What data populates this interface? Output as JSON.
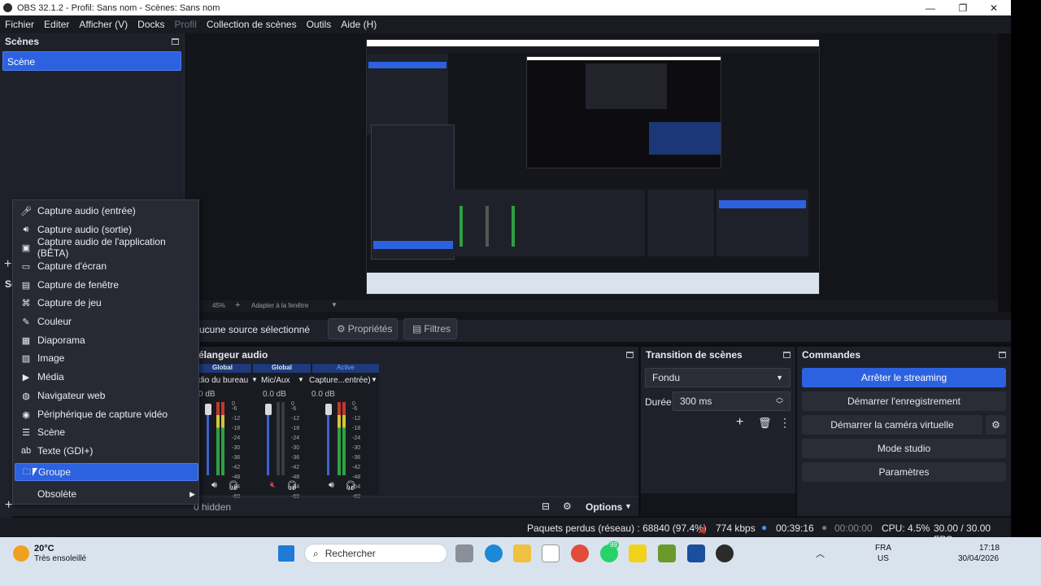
{
  "window": {
    "title": "OBS 32.1.2 - Profil: Sans nom - Scènes: Sans nom"
  },
  "menubar": [
    "Fichier",
    "Editer",
    "Afficher (V)",
    "Docks",
    "Profil",
    "Collection de scènes",
    "Outils",
    "Aide (H)"
  ],
  "scenes": {
    "title": "Scènes",
    "items": [
      "Scène"
    ]
  },
  "preview": {
    "zoom": "45%",
    "fit_label": "Adapter à la fenêtre"
  },
  "sources_bar": {
    "no_source": "ucune source sélectionné",
    "props": "Propriétés",
    "filters": "Filtres"
  },
  "mixer": {
    "title": "élangeur audio",
    "channels": [
      {
        "badge": "Global",
        "name": "dio du bureau",
        "db": "0 dB",
        "level": 0.7,
        "muted": false
      },
      {
        "badge": "Global",
        "name": "Mic/Aux",
        "db": "0.0 dB",
        "level": 0.0,
        "muted": true
      },
      {
        "badge": "Active",
        "name": "Capture...entrée)",
        "db": "0.0 dB",
        "level": 0.45,
        "muted": false
      }
    ],
    "scale": [
      "0",
      "-6",
      "-12",
      "-18",
      "-24",
      "-30",
      "-36",
      "-42",
      "-48",
      "-54",
      "-60"
    ],
    "footer": "0 hidden",
    "options_label": "Options"
  },
  "transitions": {
    "title": "Transition de scènes",
    "selected": "Fondu",
    "duration_label": "Durée",
    "duration_value": "300 ms"
  },
  "commands": {
    "title": "Commandes",
    "buttons": [
      "Arrêter le streaming",
      "Démarrer l'enregistrement",
      "Démarrer la caméra virtuelle",
      "Mode studio",
      "Paramètres"
    ]
  },
  "context_menu": {
    "items": [
      {
        "label": "Capture audio (entrée)",
        "icon": "mic-icon"
      },
      {
        "label": "Capture audio (sortie)",
        "icon": "speaker-icon"
      },
      {
        "label": "Capture audio de l'application (BÊTA)",
        "icon": "app-audio-icon"
      },
      {
        "label": "Capture d'écran",
        "icon": "monitor-icon"
      },
      {
        "label": "Capture de fenêtre",
        "icon": "window-icon"
      },
      {
        "label": "Capture de jeu",
        "icon": "gamepad-icon"
      },
      {
        "label": "Couleur",
        "icon": "brush-icon"
      },
      {
        "label": "Diaporama",
        "icon": "slideshow-icon"
      },
      {
        "label": "Image",
        "icon": "image-icon"
      },
      {
        "label": "Média",
        "icon": "play-icon"
      },
      {
        "label": "Navigateur web",
        "icon": "globe-icon"
      },
      {
        "label": "Périphérique de capture vidéo",
        "icon": "camera-icon"
      },
      {
        "label": "Scène",
        "icon": "list-icon"
      },
      {
        "label": "Texte (GDI+)",
        "icon": "text-icon"
      },
      {
        "label": "Groupe",
        "icon": "folder-icon"
      },
      {
        "label": "Obsolète",
        "icon": ""
      }
    ]
  },
  "status": {
    "dropped": "Paquets perdus (réseau) : 68840 (97.4%)",
    "bitrate": "774 kbps",
    "stream_time": "00:39:16",
    "rec_time": "00:00:00",
    "cpu": "CPU: 4.5%",
    "fps": "30.00 / 30.00 FPS"
  },
  "taskbar": {
    "temp": "20°C",
    "weather": "Très ensoleillé",
    "search": "Rechercher",
    "lang1": "FRA",
    "lang2": "US",
    "time": "17:18",
    "date": "30/04/2026",
    "badge": "99"
  },
  "colors": {
    "accent": "#2c62e0",
    "panel": "#1f212a",
    "bg": "#14151b"
  }
}
